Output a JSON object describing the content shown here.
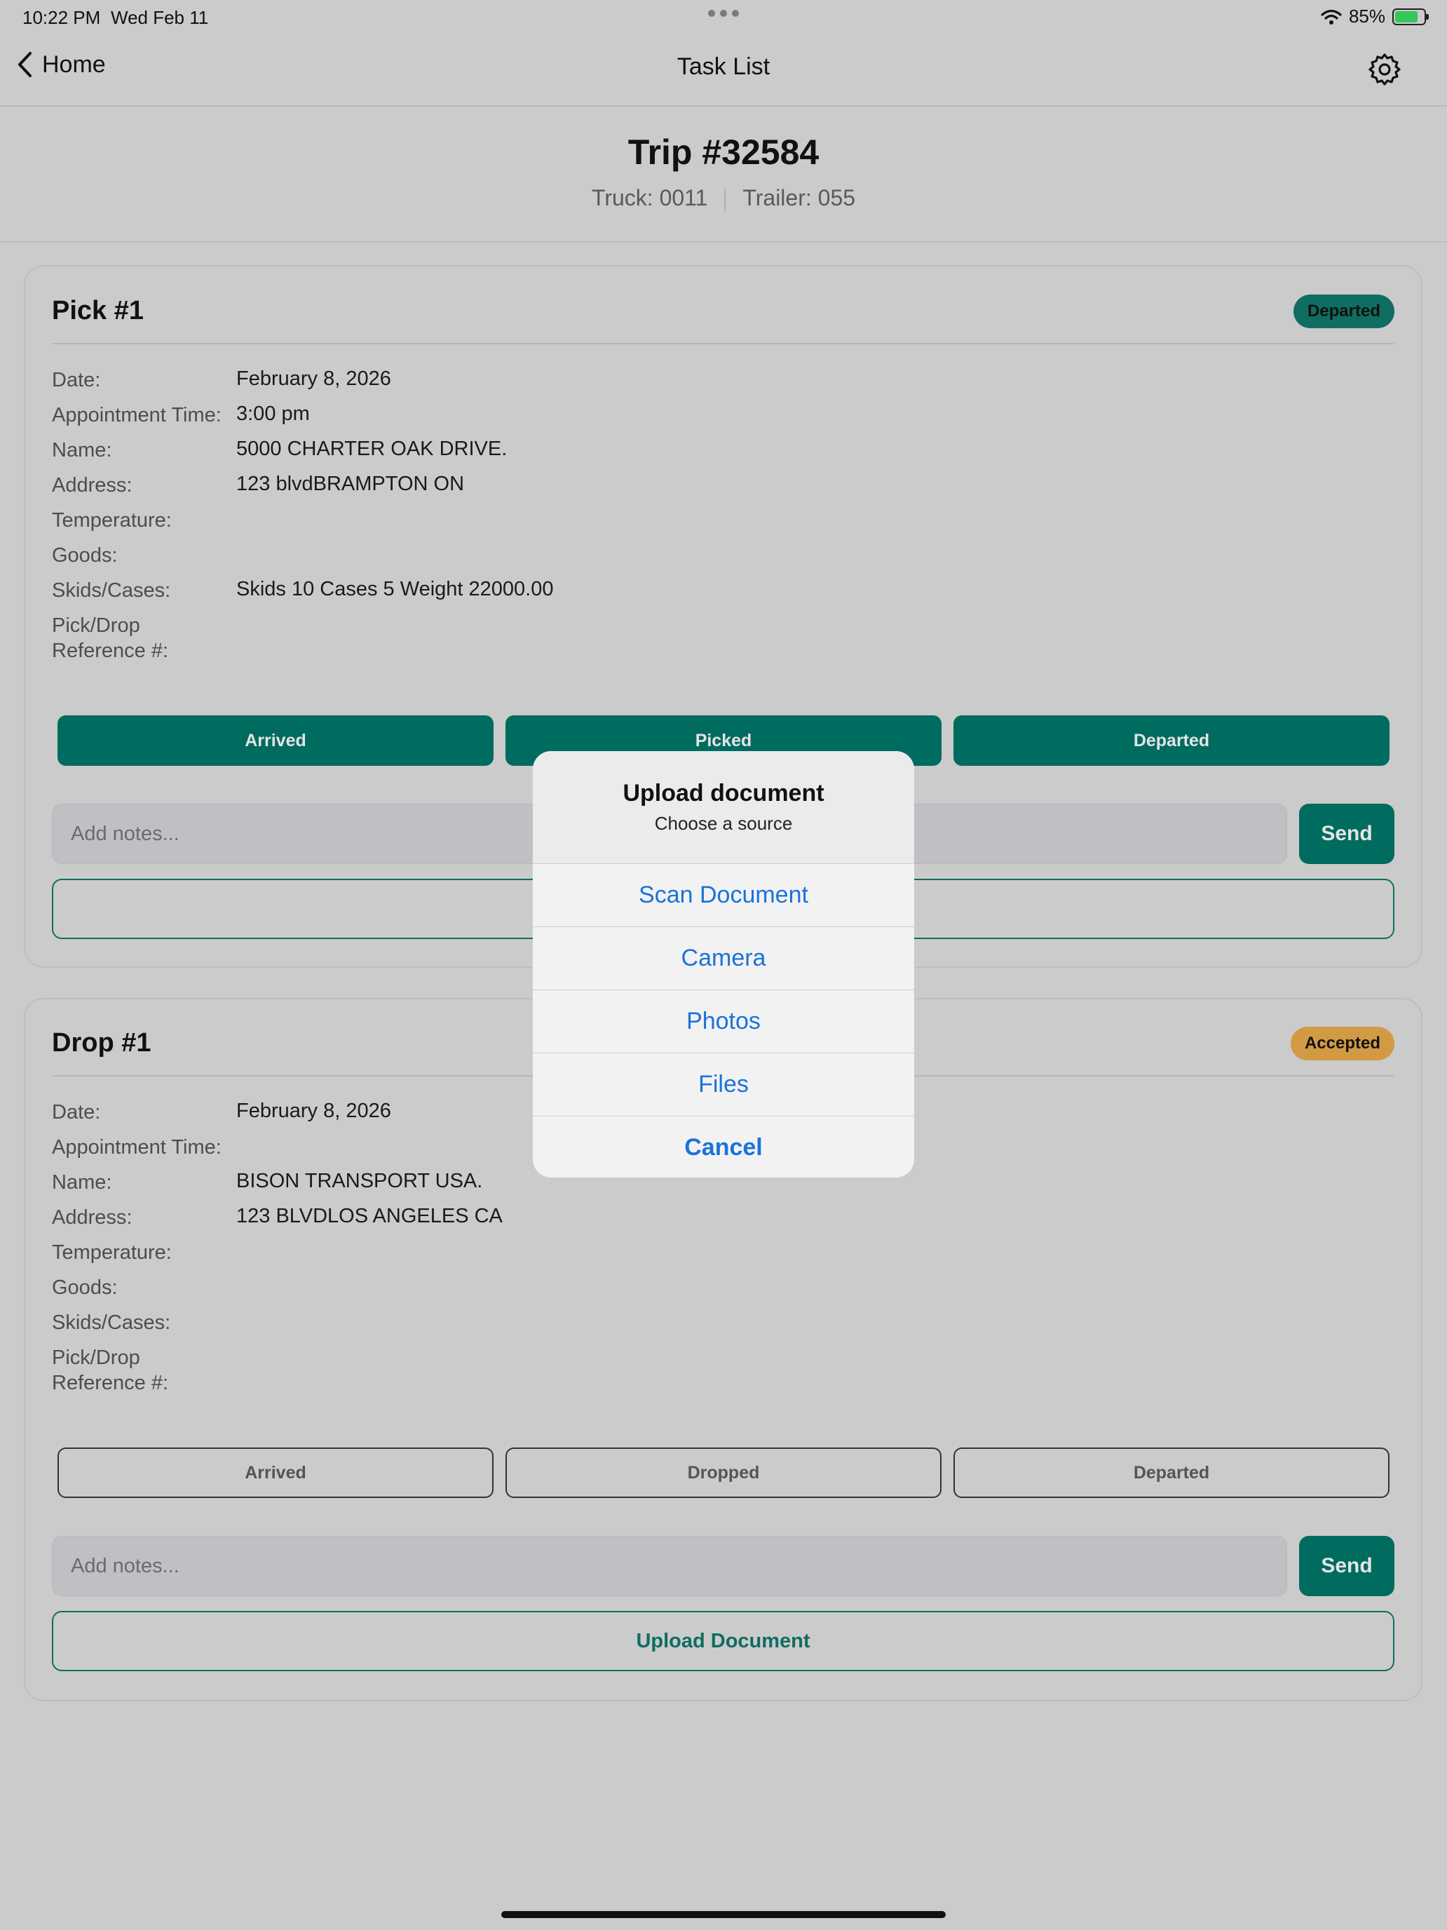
{
  "status": {
    "time": "10:22 PM",
    "date": "Wed Feb 11",
    "battery": "85%"
  },
  "nav": {
    "back_label": "Home",
    "title": "Task List"
  },
  "trip": {
    "title": "Trip #32584",
    "truck": "Truck: 0011",
    "trailer": "Trailer: 055"
  },
  "labels": {
    "date": "Date:",
    "appt": "Appointment Time:",
    "name": "Name:",
    "address": "Address:",
    "temperature": "Temperature:",
    "goods": "Goods:",
    "skids": "Skids/Cases:",
    "ref_line1": "Pick/Drop",
    "ref_line2": "Reference #:"
  },
  "pick": {
    "title": "Pick #1",
    "badge": "Departed",
    "date": "February 8, 2026",
    "appt": "3:00 pm",
    "name": "5000 CHARTER OAK DRIVE.",
    "address": "123 blvdBRAMPTON ON",
    "temperature": "",
    "goods": "",
    "skids": "Skids 10 Cases 5 Weight 22000.00",
    "ref": "",
    "buttons": [
      "Arrived",
      "Picked",
      "Departed"
    ],
    "notes_placeholder": "Add notes...",
    "send": "Send"
  },
  "drop": {
    "title": "Drop #1",
    "badge": "Accepted",
    "date": "February 8, 2026",
    "appt": "",
    "name": "BISON TRANSPORT USA.",
    "address": "123 BLVDLOS ANGELES CA",
    "temperature": "",
    "goods": "",
    "skids": "",
    "ref": "",
    "buttons": [
      "Arrived",
      "Dropped",
      "Departed"
    ],
    "notes_placeholder": "Add notes...",
    "send": "Send",
    "upload": "Upload Document"
  },
  "modal": {
    "title": "Upload document",
    "subtitle": "Choose a source",
    "options": [
      "Scan Document",
      "Camera",
      "Photos",
      "Files"
    ],
    "cancel": "Cancel"
  },
  "colors": {
    "accent": "#006b5f",
    "badge_accepted": "#d29a45",
    "link": "#1a73d9"
  }
}
